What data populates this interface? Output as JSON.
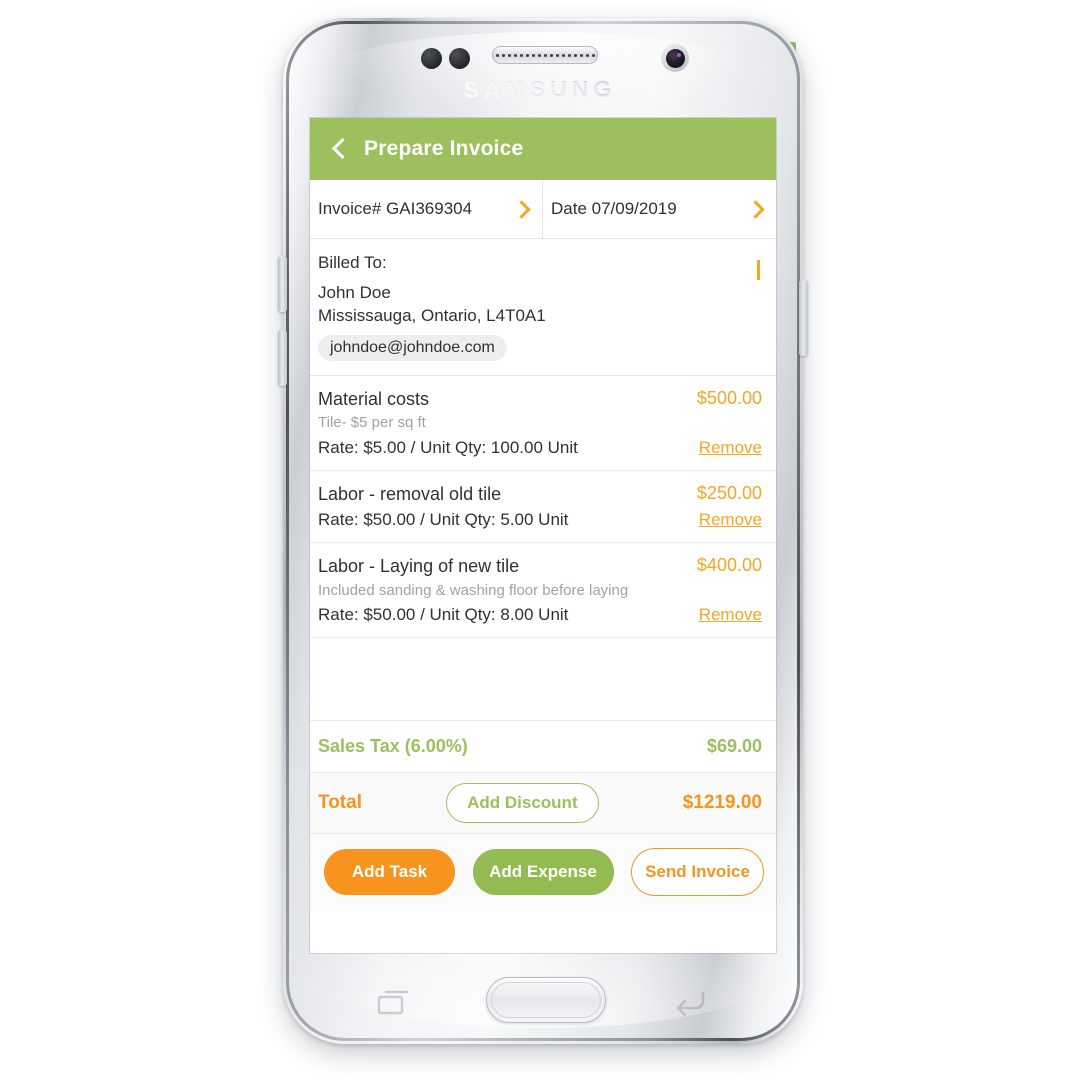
{
  "device": {
    "brand": "SAMSUNG",
    "hardware": {
      "speaker_name": "earpiece-speaker",
      "camera_name": "front-camera",
      "sensor_name": "proximity-sensor",
      "home_name": "home-button",
      "recents_name": "recents-nav-icon",
      "back_name": "back-nav-icon"
    }
  },
  "colors": {
    "green": "#9dbf5e",
    "orange": "#f5a623",
    "orange_deep": "#f7941e",
    "gray_text": "#9fa3a7",
    "dark_text": "#2f3133"
  },
  "app": {
    "header": {
      "title": "Prepare Invoice",
      "back_icon": "back-chevron-icon"
    },
    "meta": [
      {
        "label": "Invoice# GAI369304",
        "name": "invoice-number-field"
      },
      {
        "label": "Date 07/09/2019",
        "name": "invoice-date-field"
      }
    ],
    "billed_to": {
      "title": "Billed To:",
      "name": "John Doe",
      "address": "Mississauga, Ontario, L4T0A1",
      "email": "johndoe@johndoe.com"
    },
    "items": [
      {
        "name": "Material costs",
        "amount": "$500.00",
        "description": "Tile- $5 per sq ft",
        "rate": "Rate: $5.00 / Unit  Qty: 100.00 Unit",
        "remove_label": "Remove"
      },
      {
        "name": "Labor - removal old tile",
        "amount": "$250.00",
        "description": "",
        "rate": "Rate: $50.00 / Unit  Qty: 5.00 Unit",
        "remove_label": "Remove"
      },
      {
        "name": "Labor - Laying of new tile",
        "amount": "$400.00",
        "description": "Included sanding & washing floor before laying",
        "rate": "Rate: $50.00 / Unit  Qty: 8.00 Unit",
        "remove_label": "Remove"
      }
    ],
    "tax": {
      "label": "Sales Tax (6.00%)",
      "amount": "$69.00"
    },
    "total": {
      "label": "Total",
      "discount_label": "Add Discount",
      "amount": "$1219.00"
    },
    "actions": {
      "add_task": "Add Task",
      "add_expense": "Add Expense",
      "send_invoice": "Send Invoice"
    }
  }
}
